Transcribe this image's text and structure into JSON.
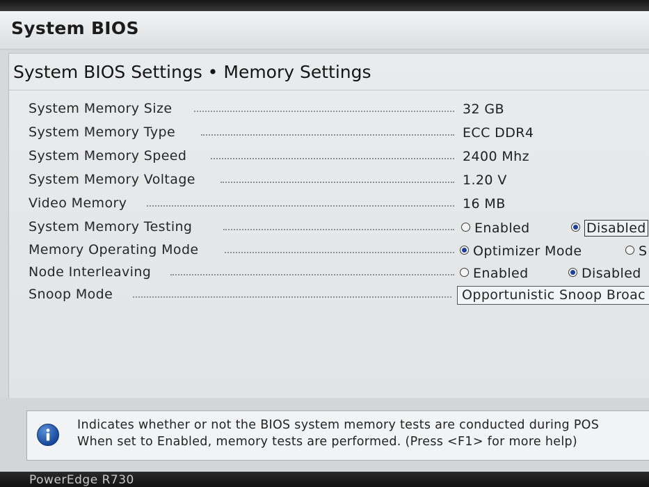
{
  "window": {
    "title": "System BIOS"
  },
  "page": {
    "heading": "System BIOS Settings • Memory Settings"
  },
  "settings": [
    {
      "label": "System Memory Size",
      "value": "32 GB"
    },
    {
      "label": "System Memory Type",
      "value": "ECC DDR4"
    },
    {
      "label": "System Memory Speed",
      "value": "2400 Mhz"
    },
    {
      "label": "System Memory Voltage",
      "value": "1.20 V"
    },
    {
      "label": "Video Memory",
      "value": "16 MB"
    },
    {
      "label": "System Memory Testing",
      "options": [
        {
          "label": "Enabled",
          "selected": false
        },
        {
          "label": "Disabled",
          "selected": true
        }
      ]
    },
    {
      "label": "Memory Operating Mode",
      "options": [
        {
          "label": "Optimizer Mode",
          "selected": true
        },
        {
          "label": "S",
          "selected": false
        }
      ]
    },
    {
      "label": "Node Interleaving",
      "options": [
        {
          "label": "Enabled",
          "selected": false
        },
        {
          "label": "Disabled",
          "selected": true
        }
      ]
    },
    {
      "label": "Snoop Mode",
      "select_value": "Opportunistic Snoop Broac"
    }
  ],
  "help": {
    "icon": "info-icon",
    "line1": "Indicates whether or not the BIOS system memory tests are conducted during POS",
    "line2": "When set to Enabled, memory tests are performed. (Press <F1> for more help)"
  },
  "footer": {
    "model": "PowerEdge R730"
  },
  "colors": {
    "radio_selected": "#1d3f9a",
    "info_icon": "#174a9b"
  }
}
